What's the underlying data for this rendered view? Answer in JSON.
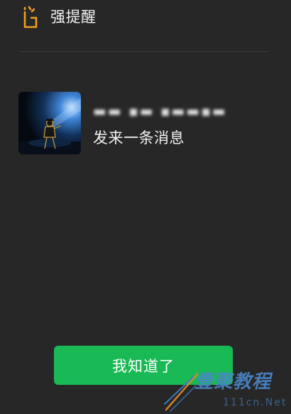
{
  "header": {
    "icon": "lightbulb-alert-icon",
    "title": "强提醒",
    "accent_color": "#f0a020"
  },
  "message": {
    "avatar": "singer-on-stage-photo",
    "sender_name": "▬▬ ▪▬ ▪▬▬▪▬",
    "sender_blurred": true,
    "text": "发来一条消息"
  },
  "actions": {
    "confirm_label": "我知道了",
    "confirm_color": "#19b955"
  },
  "watermark": {
    "text": "壹聚教程",
    "url": "111cn.Net"
  }
}
